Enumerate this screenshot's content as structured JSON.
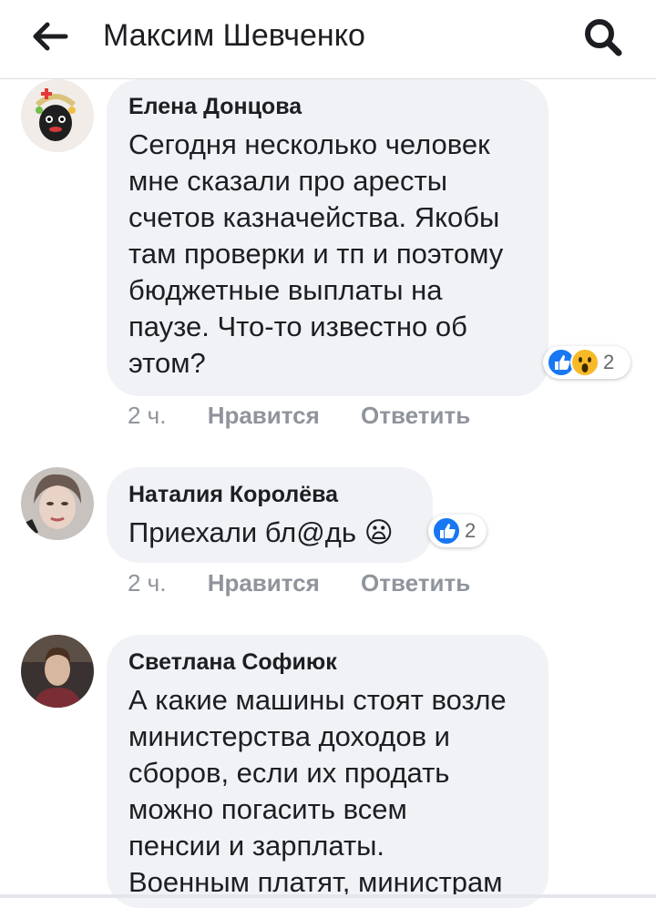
{
  "header": {
    "title": "Максим Шевченко",
    "back_icon": "arrow-left-icon",
    "search_icon": "search-icon"
  },
  "colors": {
    "bubble": "#f0f2f5",
    "like_blue": "#1877f2",
    "wow_yellow": "#f7b928",
    "meta_gray": "#90949c"
  },
  "comments": [
    {
      "author": "Елена Донцова",
      "text": "Сегодня несколько человек\nмне сказали про аресты\nсчетов казначейства. Якобы\nтам проверки и тп и поэтому\nбюджетные выплаты на\nпаузе. Что-то известно об\nэтом?",
      "reactions": {
        "icons": [
          "like-icon",
          "wow-icon"
        ],
        "count": "2"
      },
      "time": "2 ч.",
      "like_label": "Нравится",
      "reply_label": "Ответить"
    },
    {
      "author": "Наталия Королёва",
      "text": "Приехали бл@дь 😦",
      "reactions": {
        "icons": [
          "like-icon"
        ],
        "count": "2"
      },
      "time": "2 ч.",
      "like_label": "Нравится",
      "reply_label": "Ответить"
    },
    {
      "author": "Светлана Софиюк",
      "text": "А какие машины стоят возле\nминистерства доходов и\nсборов, если их продать\nможно погасить всем\nпенсии и зарплаты.\nВоенным платят, министрам"
    }
  ]
}
